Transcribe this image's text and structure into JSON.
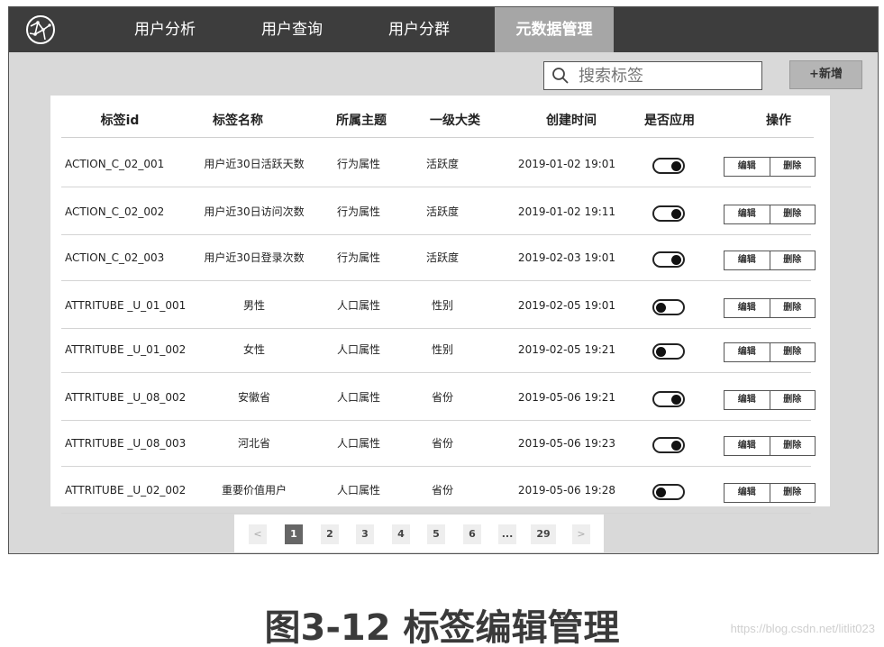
{
  "nav": {
    "logo_icon": "globe-network-icon",
    "items": [
      {
        "label": "用户分析",
        "active": false
      },
      {
        "label": "用户查询",
        "active": false
      },
      {
        "label": "用户分群",
        "active": false
      },
      {
        "label": "元数据管理",
        "active": true
      }
    ]
  },
  "toolbar": {
    "search_icon": "search-icon",
    "search_placeholder": "搜索标签",
    "add_label": "+新增"
  },
  "table": {
    "headers": [
      "标签id",
      "标签名称",
      "所属主题",
      "一级大类",
      "创建时间",
      "是否应用",
      "操作"
    ],
    "rows": [
      {
        "id": "ACTION_C_02_001",
        "name": "用户近30日活跃天数",
        "theme": "行为属性",
        "category": "活跃度",
        "created": "2019-01-02 19:01",
        "applied": true,
        "edit": "编辑",
        "delete": "删除"
      },
      {
        "id": "ACTION_C_02_002",
        "name": "用户近30日访问次数",
        "theme": "行为属性",
        "category": "活跃度",
        "created": "2019-01-02 19:11",
        "applied": true,
        "edit": "编辑",
        "delete": "删除"
      },
      {
        "id": "ACTION_C_02_003",
        "name": "用户近30日登录次数",
        "theme": "行为属性",
        "category": "活跃度",
        "created": "2019-02-03 19:01",
        "applied": true,
        "edit": "编辑",
        "delete": "删除"
      },
      {
        "id": "ATTRITUBE _U_01_001",
        "name": "男性",
        "theme": "人口属性",
        "category": "性别",
        "created": "2019-02-05 19:01",
        "applied": false,
        "edit": "编辑",
        "delete": "删除"
      },
      {
        "id": "ATTRITUBE _U_01_002",
        "name": "女性",
        "theme": "人口属性",
        "category": "性别",
        "created": "2019-02-05 19:21",
        "applied": false,
        "edit": "编辑",
        "delete": "删除"
      },
      {
        "id": "ATTRITUBE _U_08_002",
        "name": "安徽省",
        "theme": "人口属性",
        "category": "省份",
        "created": "2019-05-06 19:21",
        "applied": true,
        "edit": "编辑",
        "delete": "删除"
      },
      {
        "id": "ATTRITUBE _U_08_003",
        "name": "河北省",
        "theme": "人口属性",
        "category": "省份",
        "created": "2019-05-06 19:23",
        "applied": true,
        "edit": "编辑",
        "delete": "删除"
      },
      {
        "id": "ATTRITUBE _U_02_002",
        "name": "重要价值用户",
        "theme": "人口属性",
        "category": "省份",
        "created": "2019-05-06 19:28",
        "applied": false,
        "edit": "编辑",
        "delete": "删除"
      }
    ]
  },
  "pagination": {
    "prev": "<",
    "pages": [
      "1",
      "2",
      "3",
      "4",
      "5",
      "6",
      "...",
      "29"
    ],
    "current": "1",
    "next": ">"
  },
  "caption": "图3-12 标签编辑管理",
  "watermark": "https://blog.csdn.net/litlit023",
  "colors": {
    "navbar_bg": "#3d3d3d",
    "nav_active_bg": "#a6a6a6",
    "page_bg": "#d9d9d9",
    "pager_active": "#666666"
  }
}
